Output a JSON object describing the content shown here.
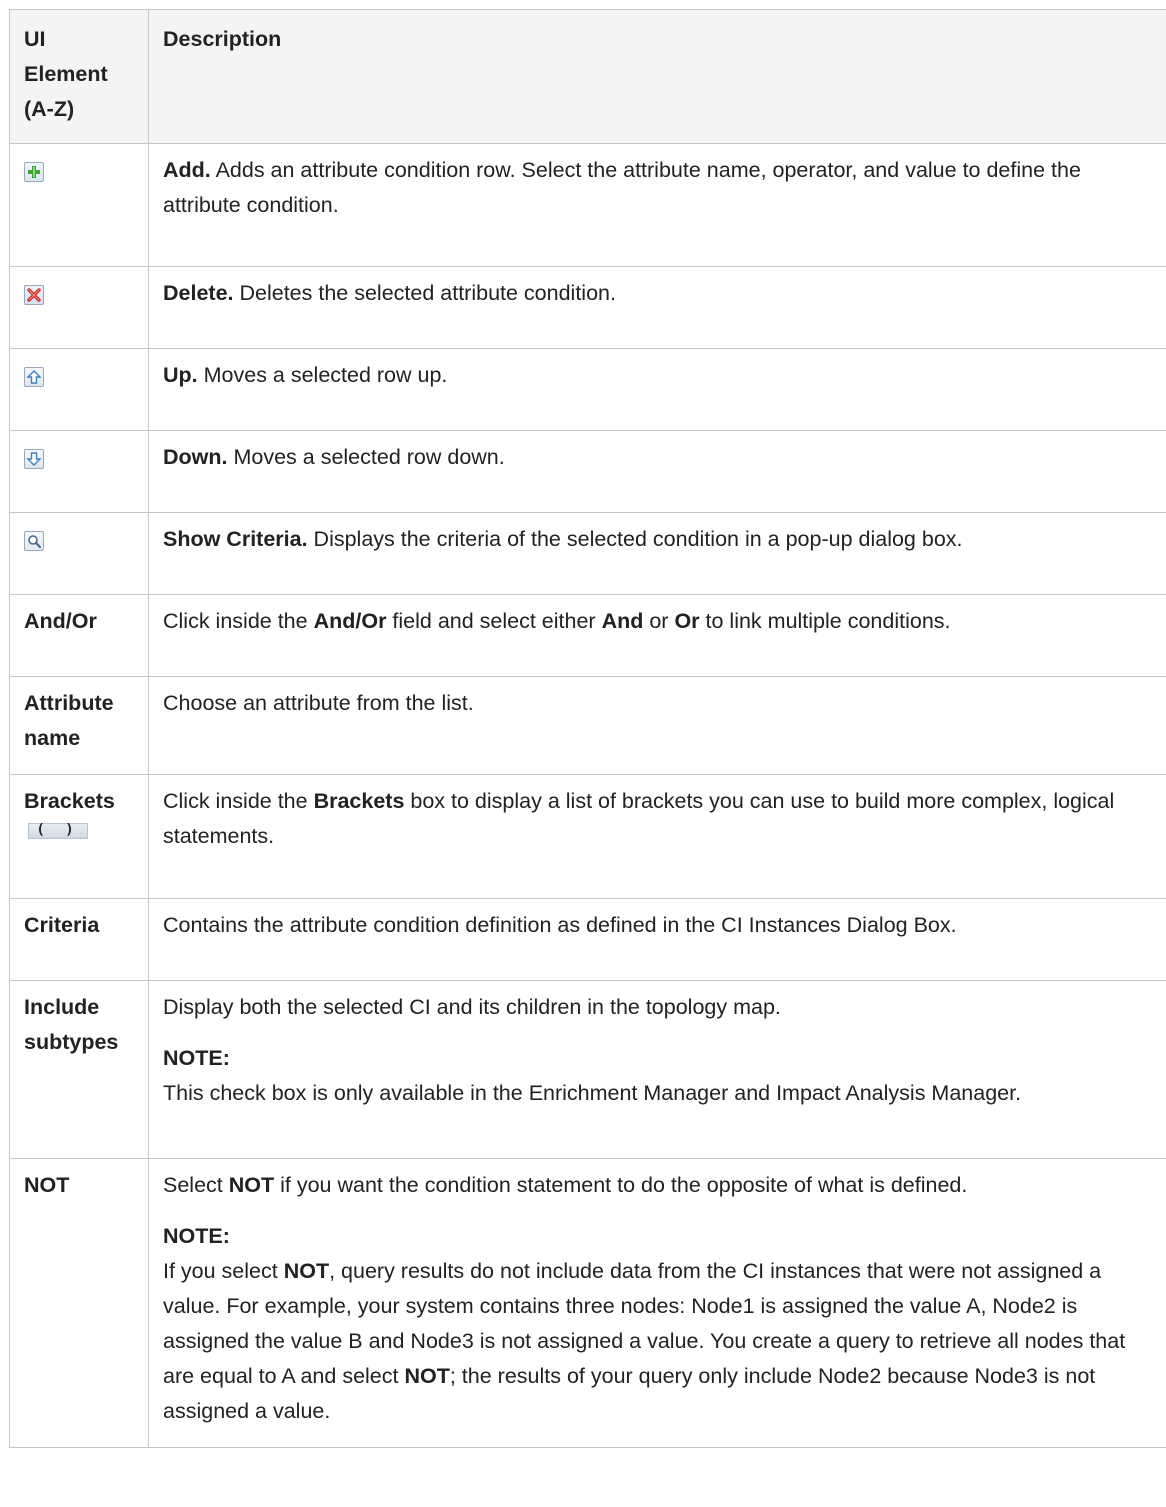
{
  "header": {
    "ui_element": "UI Element (A-Z)",
    "description": "Description"
  },
  "rows": [
    {
      "icon": "add-icon",
      "name": "Add.",
      "text": " Adds an attribute condition row. Select the attribute name, operator, and value to define the attribute condition."
    },
    {
      "icon": "delete-icon",
      "name": "Delete.",
      "text": " Deletes the selected attribute condition."
    },
    {
      "icon": "up-icon",
      "name": "Up.",
      "text": " Moves a selected row up."
    },
    {
      "icon": "down-icon",
      "name": "Down.",
      "text": " Moves a selected row down."
    },
    {
      "icon": "show-criteria-icon",
      "name": "Show Criteria.",
      "text": " Displays the criteria of the selected condition in a pop-up dialog box."
    }
  ],
  "and_or": {
    "element": "And/Or",
    "t1": "Click inside the ",
    "b1": "And/Or",
    "t2": " field and select either ",
    "b2": "And",
    "t3": " or ",
    "b3": "Or",
    "t4": " to link multiple conditions."
  },
  "attribute_name": {
    "element": "Attribute name",
    "text": "Choose an attribute from the list."
  },
  "brackets": {
    "element": "Brackets",
    "icon_text": "( )",
    "t1": "Click inside the ",
    "b1": "Brackets",
    "t2": " box to display a list of brackets you can use to build more complex, logical statements."
  },
  "criteria": {
    "element": "Criteria",
    "text": "Contains the attribute condition definition as defined in the CI Instances Dialog Box."
  },
  "include_subtypes": {
    "element": "Include subtypes",
    "text": "Display both the selected CI and its children in the topology map.",
    "note_title": "NOTE:",
    "note_text": "This check box is only available in the Enrichment Manager and Impact Analysis Manager."
  },
  "not": {
    "element": "NOT",
    "t1": "Select ",
    "b1": "NOT",
    "t2": " if you want the condition statement to do the opposite of what is defined.",
    "note_title": "NOTE:",
    "n1": "If you select ",
    "nb1": "NOT",
    "n2": ", query results do not include data from the CI instances that were not assigned a value. For example, your system contains three nodes: Node1 is assigned the value A, Node2 is assigned the value B and Node3 is not assigned a value. You create a query to retrieve all nodes that are equal to A and select ",
    "nb2": "NOT",
    "n3": "; the results of your query only include Node2 because Node3 is not assigned a value."
  }
}
